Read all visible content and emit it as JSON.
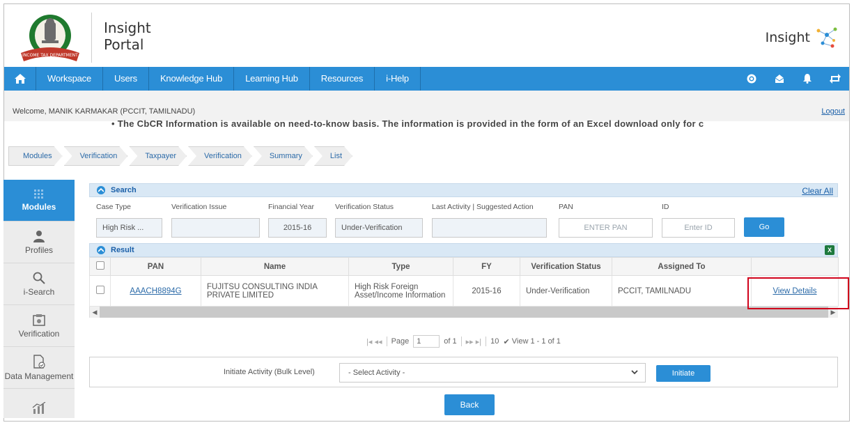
{
  "header": {
    "portal_title_line1": "Insight",
    "portal_title_line2": "Portal",
    "brand_text": "Insight",
    "emblem_banner": "INCOME TAX DEPARTMENT"
  },
  "nav": {
    "items": [
      {
        "label": "Workspace"
      },
      {
        "label": "Users"
      },
      {
        "label": "Knowledge Hub"
      },
      {
        "label": "Learning Hub"
      },
      {
        "label": "Resources"
      },
      {
        "label": "i-Help"
      }
    ],
    "right_icons": [
      "help-icon",
      "mail-icon",
      "bell-icon",
      "switch-icon"
    ]
  },
  "welcome": {
    "text": "Welcome, MANIK KARMAKAR (PCCIT, TAMILNADU)",
    "logout": "Logout"
  },
  "ticker": "• The CbCR Information is available on need-to-know basis. The information is provided in the form of an Excel download only for c",
  "breadcrumb": [
    "Modules",
    "Verification",
    "Taxpayer",
    "Verification",
    "Summary",
    "List"
  ],
  "sidebar": [
    {
      "label": "Modules",
      "icon": "modules-icon",
      "active": true
    },
    {
      "label": "Profiles",
      "icon": "profile-icon"
    },
    {
      "label": "i-Search",
      "icon": "search-icon"
    },
    {
      "label": "Verification",
      "icon": "verification-icon"
    },
    {
      "label": "Data Management",
      "icon": "data-management-icon"
    },
    {
      "label": "",
      "icon": "analytics-icon"
    }
  ],
  "search": {
    "title": "Search",
    "clear_all": "Clear All",
    "labels": {
      "case_type": "Case Type",
      "verification_issue": "Verification Issue",
      "financial_year": "Financial Year",
      "verification_status": "Verification Status",
      "last_activity": "Last Activity | Suggested Action",
      "pan": "PAN",
      "id": "ID"
    },
    "values": {
      "case_type": "High Risk ...",
      "verification_issue": "",
      "financial_year": "2015-16",
      "verification_status": "Under-Verification",
      "last_activity": ""
    },
    "placeholders": {
      "pan": "ENTER PAN",
      "id": "Enter ID"
    },
    "go": "Go"
  },
  "result": {
    "title": "Result",
    "excel_icon": "X",
    "columns": [
      "PAN",
      "Name",
      "Type",
      "FY",
      "Verification Status",
      "Assigned To",
      ""
    ],
    "rows": [
      {
        "pan": "AAACH8894G",
        "name": "FUJITSU CONSULTING INDIA PRIVATE LIMITED",
        "type": "High Risk Foreign Asset/Income Information",
        "fy": "2015-16",
        "status": "Under-Verification",
        "assigned_to": "PCCIT, TAMILNADU",
        "action": "View Details"
      }
    ]
  },
  "pager": {
    "page_label": "Page",
    "page_value": "1",
    "of_label": "of 1",
    "page_size": "10",
    "view_text": "View 1 - 1 of 1"
  },
  "bulk": {
    "label": "Initiate Activity (Bulk Level)",
    "select_value": "- Select Activity -",
    "initiate": "Initiate"
  },
  "back": "Back",
  "colors": {
    "primary": "#2b8ed6",
    "highlight": "#d0021b",
    "link": "#2b6aa8"
  }
}
